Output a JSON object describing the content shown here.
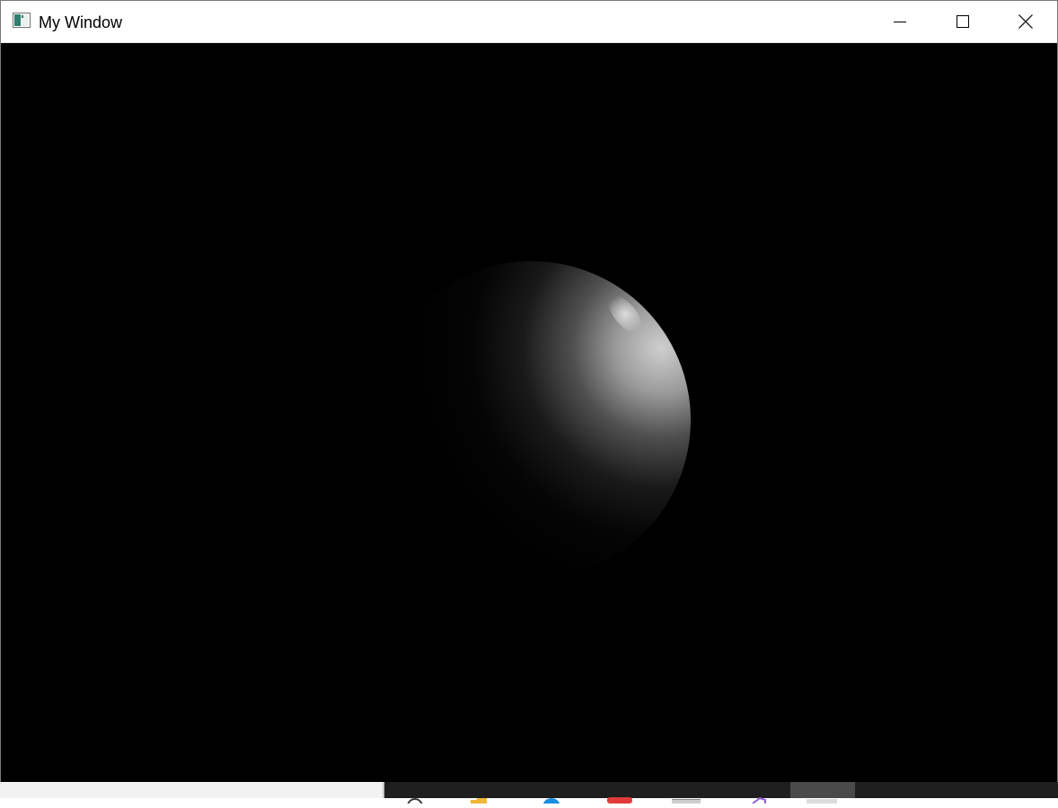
{
  "window": {
    "title": "My Window",
    "controls": {
      "minimize_icon": "minimize-icon",
      "maximize_icon": "maximize-icon",
      "close_icon": "close-icon"
    }
  },
  "canvas": {
    "background": "#000000",
    "object": "shaded-sphere",
    "highlight_color": "#d8d8d8"
  },
  "taskbar": {
    "background": "#1f1f1f",
    "search_background": "#f2f2f2",
    "icons": [
      {
        "name": "search-icon",
        "color": "#3a3a3a"
      },
      {
        "name": "file-explorer-icon",
        "color": "#f2b636"
      },
      {
        "name": "edge-icon",
        "color": "#1b8ee0"
      },
      {
        "name": "app-red-icon",
        "color": "#e03a3a"
      },
      {
        "name": "app-gray-icon",
        "color": "#cfcfcf"
      },
      {
        "name": "visual-studio-icon",
        "color": "#8e5fd1"
      },
      {
        "name": "active-window-icon",
        "color": "#dcdcdc"
      }
    ]
  }
}
